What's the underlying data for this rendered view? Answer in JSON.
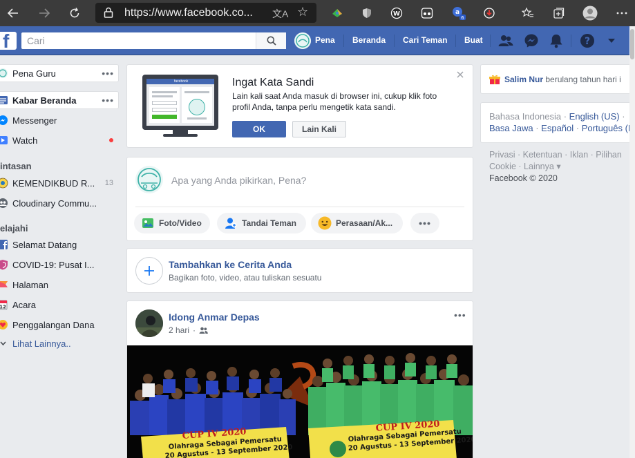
{
  "browser": {
    "url": "https://www.facebook.co..."
  },
  "topbar": {
    "search_placeholder": "Cari",
    "profile_name": "Pena",
    "home_label": "Beranda",
    "find_friends_label": "Cari Teman",
    "create_label": "Buat"
  },
  "sidebar": {
    "profile_label": "Pena Guru",
    "news_feed_label": "Kabar Beranda",
    "messenger_label": "Messenger",
    "watch_label": "Watch",
    "shortcuts_header": "intasan",
    "shortcuts": [
      {
        "label": "KEMENDIKBUD R...",
        "count": "13"
      },
      {
        "label": "Cloudinary Commu..."
      }
    ],
    "explore_header": "elajahi",
    "explore": [
      {
        "label": "Selamat Datang"
      },
      {
        "label": "COVID-19: Pusat I..."
      },
      {
        "label": "Halaman"
      },
      {
        "label": "Acara"
      },
      {
        "label": "Penggalangan Dana"
      }
    ],
    "see_more_label": "Lihat Lainnya.."
  },
  "remember_password": {
    "title": "Ingat Kata Sandi",
    "body_line1": "Lain kali saat Anda masuk di browser ini, cukup klik foto",
    "body_line2": "profil Anda, tanpa perlu mengetik kata sandi.",
    "ok_label": "OK",
    "later_label": "Lain Kali",
    "mock_header": "facebook"
  },
  "composer": {
    "placeholder": "Apa yang Anda pikirkan, Pena?",
    "photo_video_label": "Foto/Video",
    "tag_friends_label": "Tandai Teman",
    "feeling_label": "Perasaan/Ak..."
  },
  "story": {
    "title": "Tambahkan ke Cerita Anda",
    "subtitle": "Bagikan foto, video, atau tuliskan sesuatu"
  },
  "post": {
    "author": "Idong Anmar Depas",
    "time": "2 hari",
    "banner_text_left": "Olahraga Sebagai Pemersatu",
    "banner_date_left": "20 Agustus - 13 September 2020",
    "banner_text_right": "Olahraga Sebagai Pemersatu",
    "banner_date_right": "20 Agustus - 13 September 2020"
  },
  "right_column": {
    "birthday_name": "Salim Nur",
    "birthday_text": "berulang tahun hari i",
    "lang_current": "Bahasa Indonesia",
    "lang_en": "English (US)",
    "lang_jv": "Basa Jawa",
    "lang_es": "Español",
    "lang_pt": "Português (I",
    "footer_privacy": "Privasi",
    "footer_terms": "Ketentuan",
    "footer_ads": "Iklan",
    "footer_choices": "Pilihan",
    "footer_cookie": "Cookie",
    "footer_more": "Lainnya",
    "copyright": "Facebook © 2020"
  },
  "colors": {
    "fb_blue": "#4267b2",
    "link_blue": "#365899",
    "background": "#e9ebee",
    "notification_red": "#fa3e3e"
  }
}
